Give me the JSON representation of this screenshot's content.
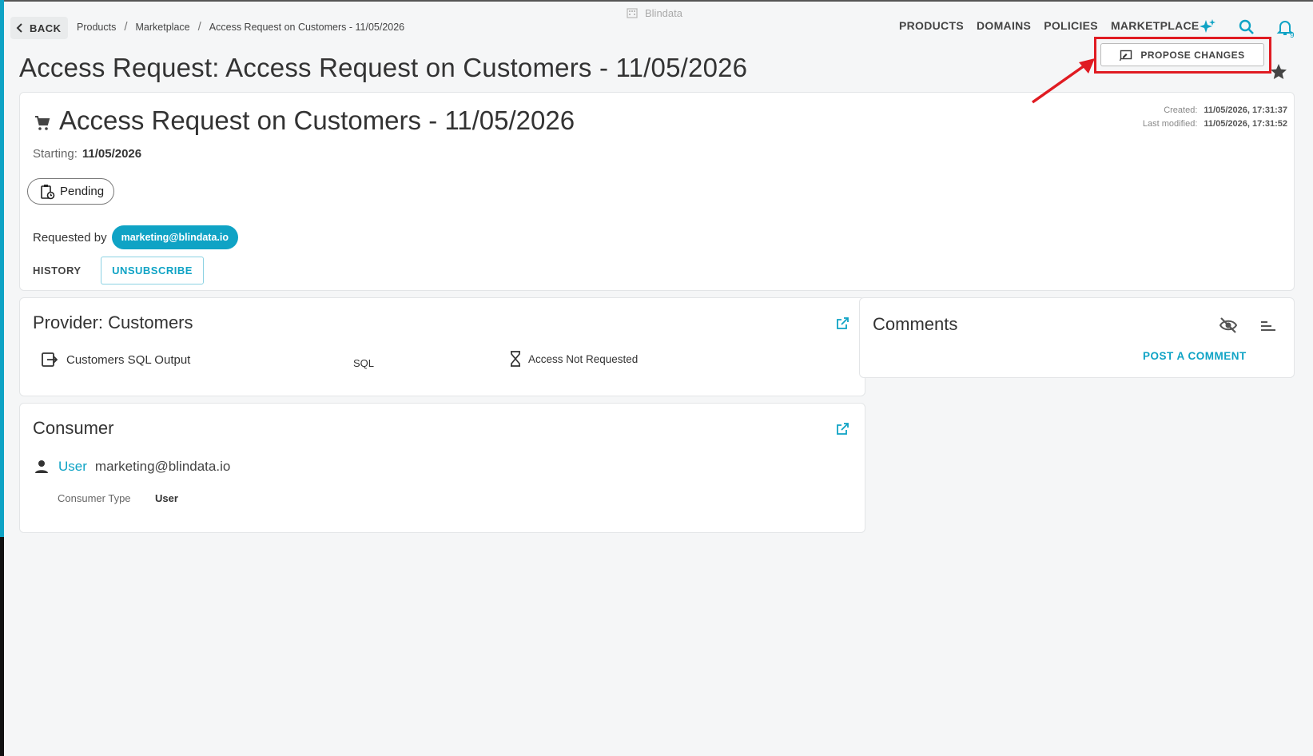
{
  "header": {
    "back_label": "BACK",
    "breadcrumb": [
      "Products",
      "Marketplace",
      "Access Request on Customers - 11/05/2026"
    ],
    "brand": "Blindata",
    "nav": [
      "PRODUCTS",
      "DOMAINS",
      "POLICIES",
      "MARKETPLACE"
    ],
    "notification_count": "9",
    "icons": [
      "back-chevron-icon",
      "building-icon",
      "sparkles-icon",
      "search-icon",
      "bell-icon"
    ]
  },
  "page": {
    "title": "Access Request: Access Request on Customers - 11/05/2026"
  },
  "request": {
    "title": "Access Request on Customers - 11/05/2026",
    "starting_label": "Starting:",
    "starting_value": "11/05/2026",
    "status": "Pending",
    "requested_by_label": "Requested by",
    "requested_by": "marketing@blindata.io",
    "history_label": "HISTORY",
    "unsubscribe_label": "UNSUBSCRIBE",
    "created_label": "Created:",
    "created_value": "11/05/2026, 17:31:37",
    "modified_label": "Last modified:",
    "modified_value": "11/05/2026, 17:31:52",
    "propose_label": "PROPOSE CHANGES"
  },
  "provider": {
    "title": "Provider: Customers",
    "port_name": "Customers SQL Output",
    "port_type": "SQL",
    "access_status": "Access Not Requested"
  },
  "consumer": {
    "title": "Consumer",
    "kind": "User",
    "identity": "marketing@blindata.io",
    "type_label": "Consumer Type",
    "type_value": "User"
  },
  "comments": {
    "title": "Comments",
    "post_label": "POST A COMMENT"
  },
  "colors": {
    "accent": "#0fa3c5",
    "highlight": "#e01b22",
    "background": "#f5f6f7"
  }
}
